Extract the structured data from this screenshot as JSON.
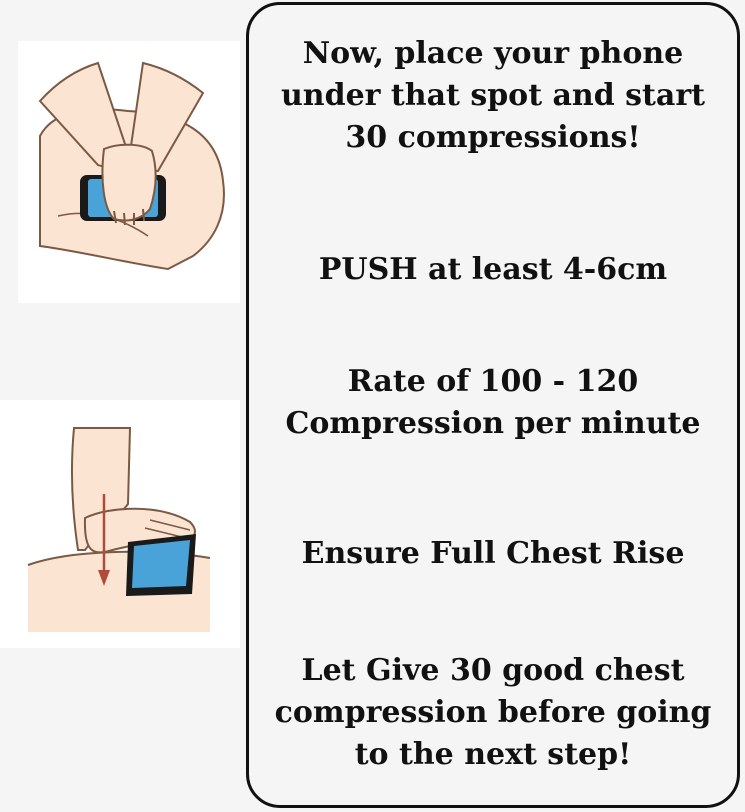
{
  "instructions": {
    "step1": "Now, place your phone\nunder that spot and start\n30 compressions!",
    "push_depth": "PUSH at least 4-6cm",
    "rate": "Rate of 100 - 120\nCompression per minute",
    "chest_rise": "Ensure Full Chest Rise",
    "final": "Let Give 30 good chest\ncompression before going\nto the next step!"
  },
  "colors": {
    "skin": "#fbe4d2",
    "skin_outline": "#7a5a44",
    "phone": "#1a1a1a",
    "screen": "#4aa3d8",
    "arrow": "#b04a3a",
    "panel_border": "#111111"
  },
  "icons": {
    "illustration_top": "hands-on-phone-chest-icon",
    "illustration_bottom": "hand-pressing-phone-side-icon"
  }
}
